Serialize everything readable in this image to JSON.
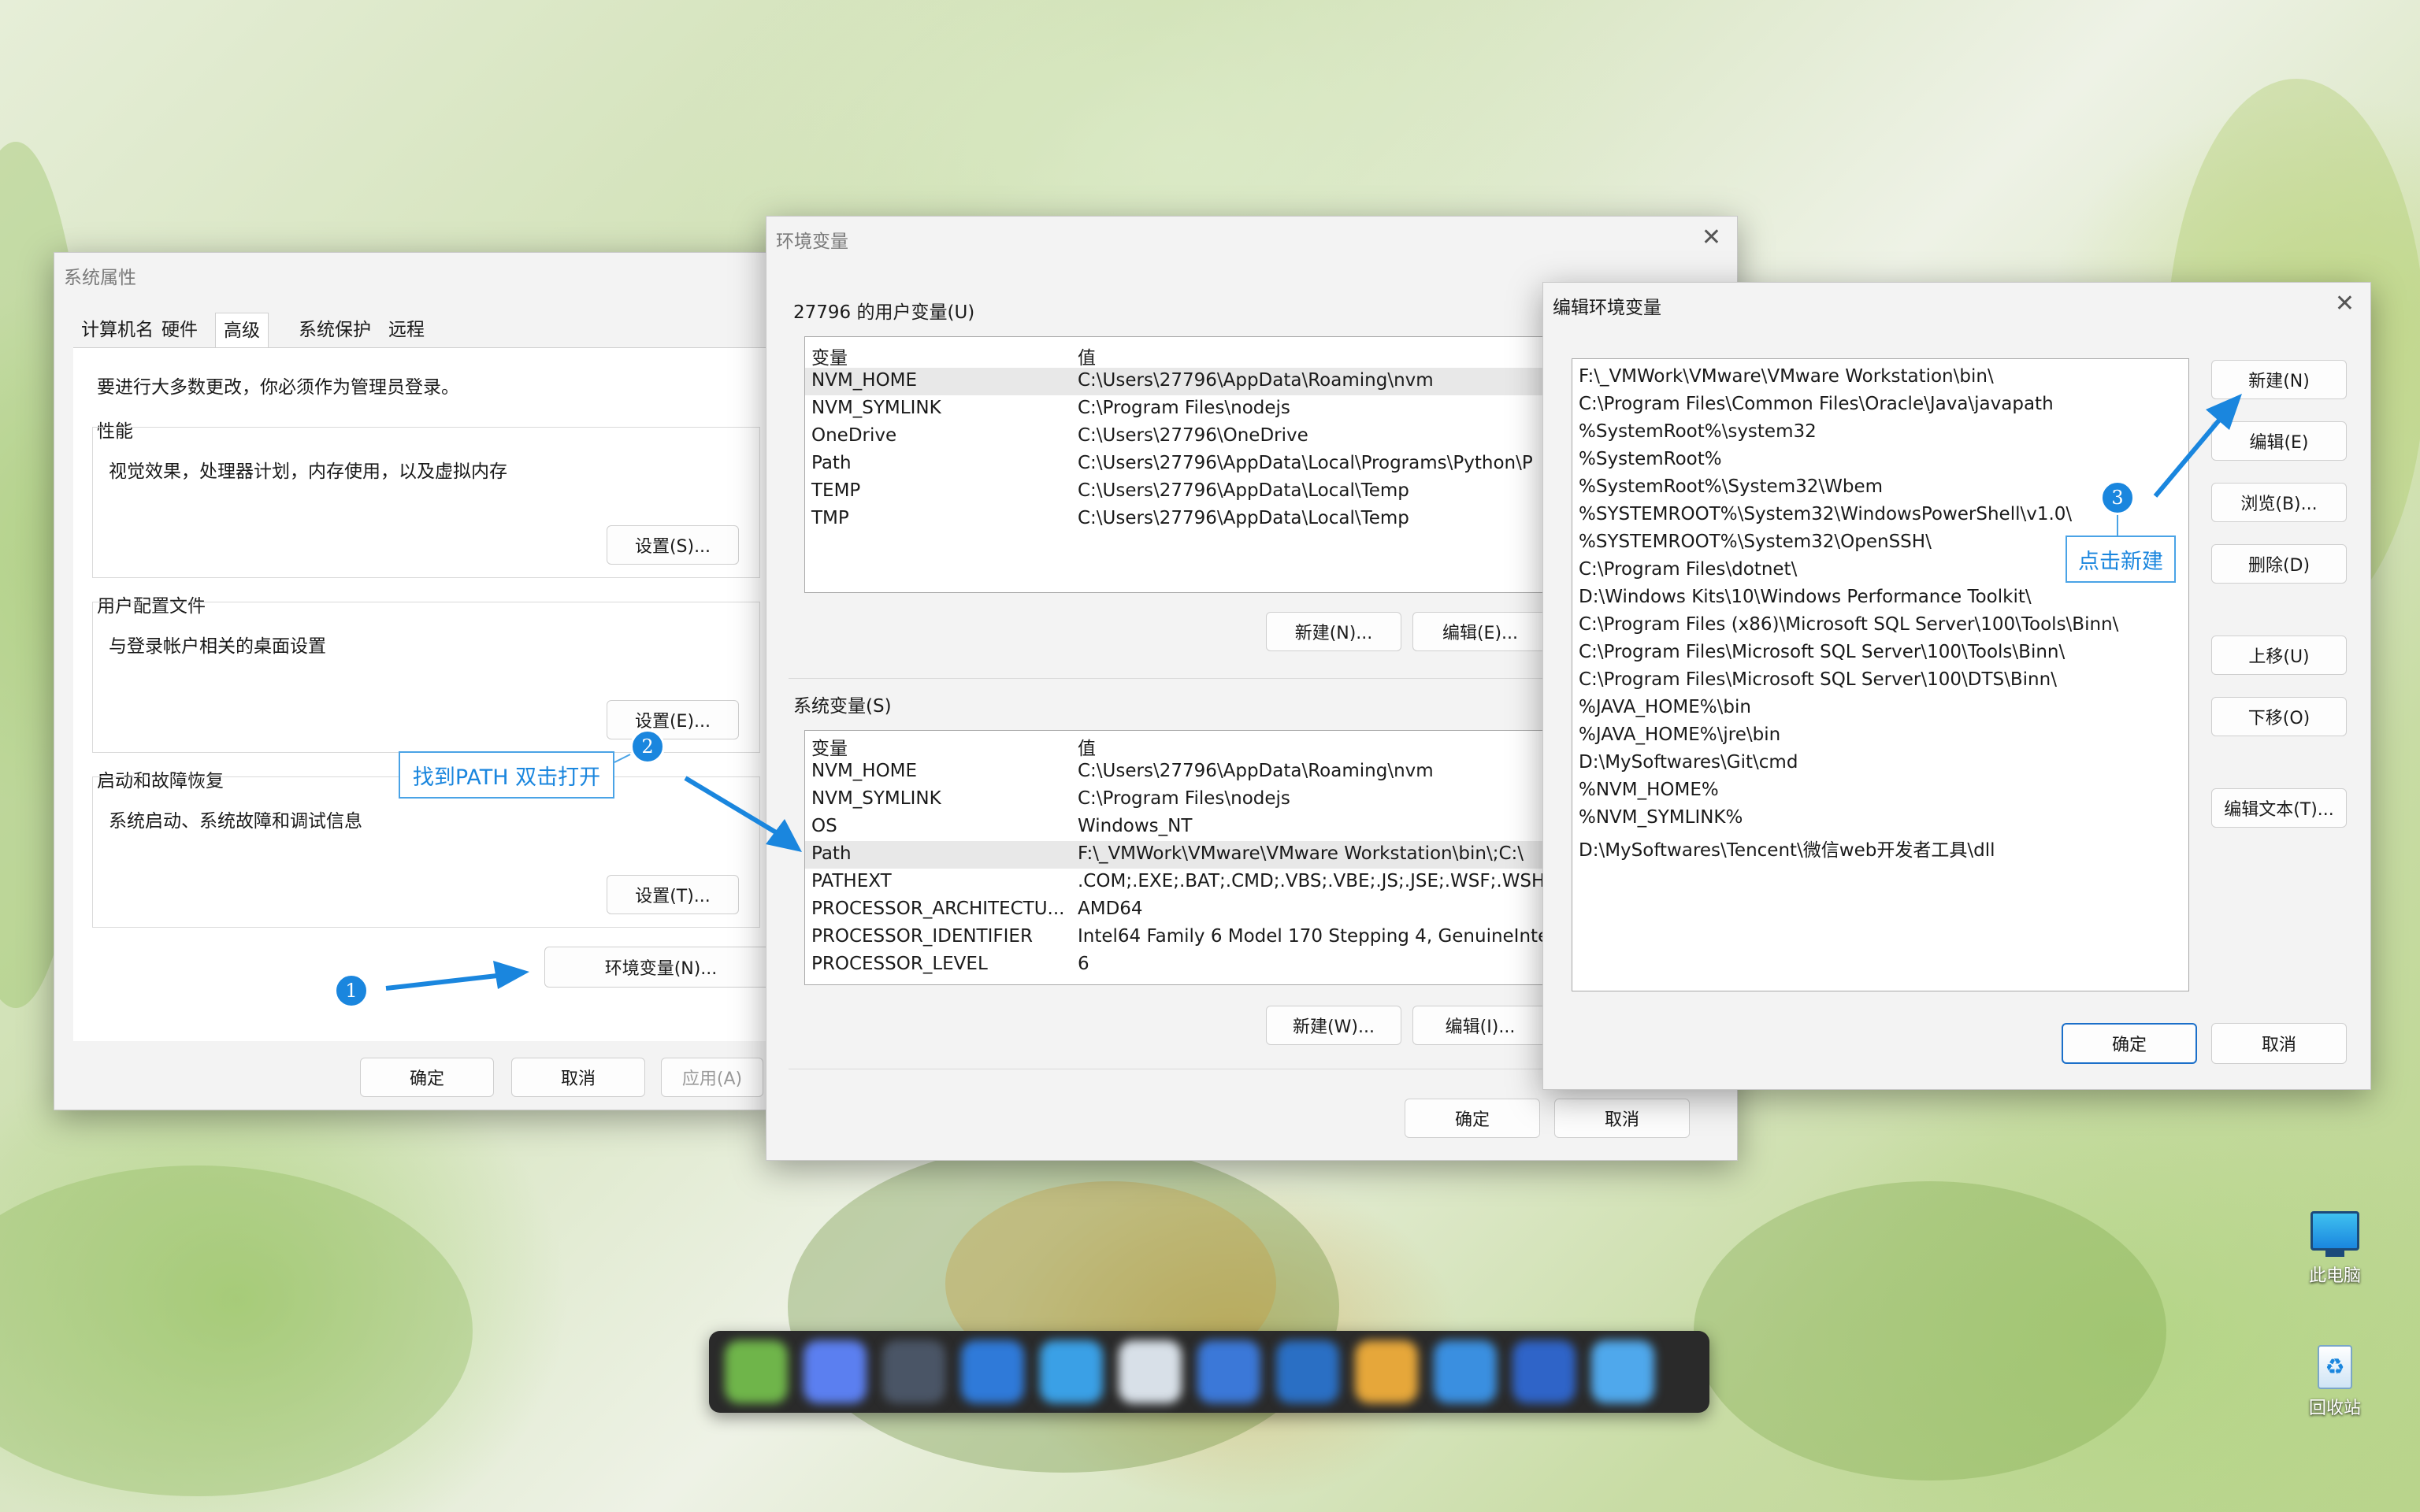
{
  "sysprops": {
    "title": "系统属性",
    "tabs": [
      "计算机名",
      "硬件",
      "高级",
      "系统保护",
      "远程"
    ],
    "active_tab": "高级",
    "admin_note": "要进行大多数更改，你必须作为管理员登录。",
    "performance": {
      "title": "性能",
      "desc": "视觉效果，处理器计划，内存使用，以及虚拟内存",
      "button": "设置(S)..."
    },
    "profiles": {
      "title": "用户配置文件",
      "desc": "与登录帐户相关的桌面设置",
      "button": "设置(E)..."
    },
    "startup": {
      "title": "启动和故障恢复",
      "desc": "系统启动、系统故障和调试信息",
      "button": "设置(T)..."
    },
    "env_button": "环境变量(N)...",
    "ok": "确定",
    "cancel": "取消",
    "apply": "应用(A)"
  },
  "envvars": {
    "title": "环境变量",
    "user_section": "27796 的用户变量(U)",
    "col_var": "变量",
    "col_val": "值",
    "user_vars": [
      {
        "name": "NVM_HOME",
        "value": "C:\\Users\\27796\\AppData\\Roaming\\nvm"
      },
      {
        "name": "NVM_SYMLINK",
        "value": "C:\\Program Files\\nodejs"
      },
      {
        "name": "OneDrive",
        "value": "C:\\Users\\27796\\OneDrive"
      },
      {
        "name": "Path",
        "value": "C:\\Users\\27796\\AppData\\Local\\Programs\\Python\\P"
      },
      {
        "name": "TEMP",
        "value": "C:\\Users\\27796\\AppData\\Local\\Temp"
      },
      {
        "name": "TMP",
        "value": "C:\\Users\\27796\\AppData\\Local\\Temp"
      }
    ],
    "user_new": "新建(N)...",
    "user_edit": "编辑(E)...",
    "sys_section": "系统变量(S)",
    "sys_vars": [
      {
        "name": "NVM_HOME",
        "value": "C:\\Users\\27796\\AppData\\Roaming\\nvm"
      },
      {
        "name": "NVM_SYMLINK",
        "value": "C:\\Program Files\\nodejs"
      },
      {
        "name": "OS",
        "value": "Windows_NT"
      },
      {
        "name": "Path",
        "value": "F:\\_VMWork\\VMware\\VMware Workstation\\bin\\;C:\\"
      },
      {
        "name": "PATHEXT",
        "value": ".COM;.EXE;.BAT;.CMD;.VBS;.VBE;.JS;.JSE;.WSF;.WSH;."
      },
      {
        "name": "PROCESSOR_ARCHITECTU...",
        "value": "AMD64"
      },
      {
        "name": "PROCESSOR_IDENTIFIER",
        "value": "Intel64 Family 6 Model 170 Stepping 4, GenuineInte"
      },
      {
        "name": "PROCESSOR_LEVEL",
        "value": "6"
      }
    ],
    "sys_new": "新建(W)...",
    "sys_edit": "编辑(I)...",
    "ok": "确定",
    "cancel": "取消"
  },
  "editenv": {
    "title": "编辑环境变量",
    "entries": [
      "F:\\_VMWork\\VMware\\VMware Workstation\\bin\\",
      "C:\\Program Files\\Common Files\\Oracle\\Java\\javapath",
      "%SystemRoot%\\system32",
      "%SystemRoot%",
      "%SystemRoot%\\System32\\Wbem",
      "%SYSTEMROOT%\\System32\\WindowsPowerShell\\v1.0\\",
      "%SYSTEMROOT%\\System32\\OpenSSH\\",
      "C:\\Program Files\\dotnet\\",
      "D:\\Windows Kits\\10\\Windows Performance Toolkit\\",
      "C:\\Program Files (x86)\\Microsoft SQL Server\\100\\Tools\\Binn\\",
      "C:\\Program Files\\Microsoft SQL Server\\100\\Tools\\Binn\\",
      "C:\\Program Files\\Microsoft SQL Server\\100\\DTS\\Binn\\",
      "%JAVA_HOME%\\bin",
      "%JAVA_HOME%\\jre\\bin",
      "D:\\MySoftwares\\Git\\cmd",
      "%NVM_HOME%",
      "%NVM_SYMLINK%",
      "D:\\MySoftwares\\Tencent\\微信web开发者工具\\dll"
    ],
    "btn_new": "新建(N)",
    "btn_edit": "编辑(E)",
    "btn_browse": "浏览(B)...",
    "btn_delete": "删除(D)",
    "btn_up": "上移(U)",
    "btn_down": "下移(O)",
    "btn_edit_text": "编辑文本(T)...",
    "ok": "确定",
    "cancel": "取消"
  },
  "annotations": {
    "badge1": "1",
    "badge2": "2",
    "badge3": "3",
    "callout2": "找到PATH 双击打开",
    "callout3": "点击新建",
    "accent": "#1a86de"
  },
  "desktop": {
    "icons": [
      {
        "label": "此电脑",
        "icon": "monitor-icon"
      },
      {
        "label": "回收站",
        "icon": "recycle-bin-icon"
      }
    ]
  }
}
